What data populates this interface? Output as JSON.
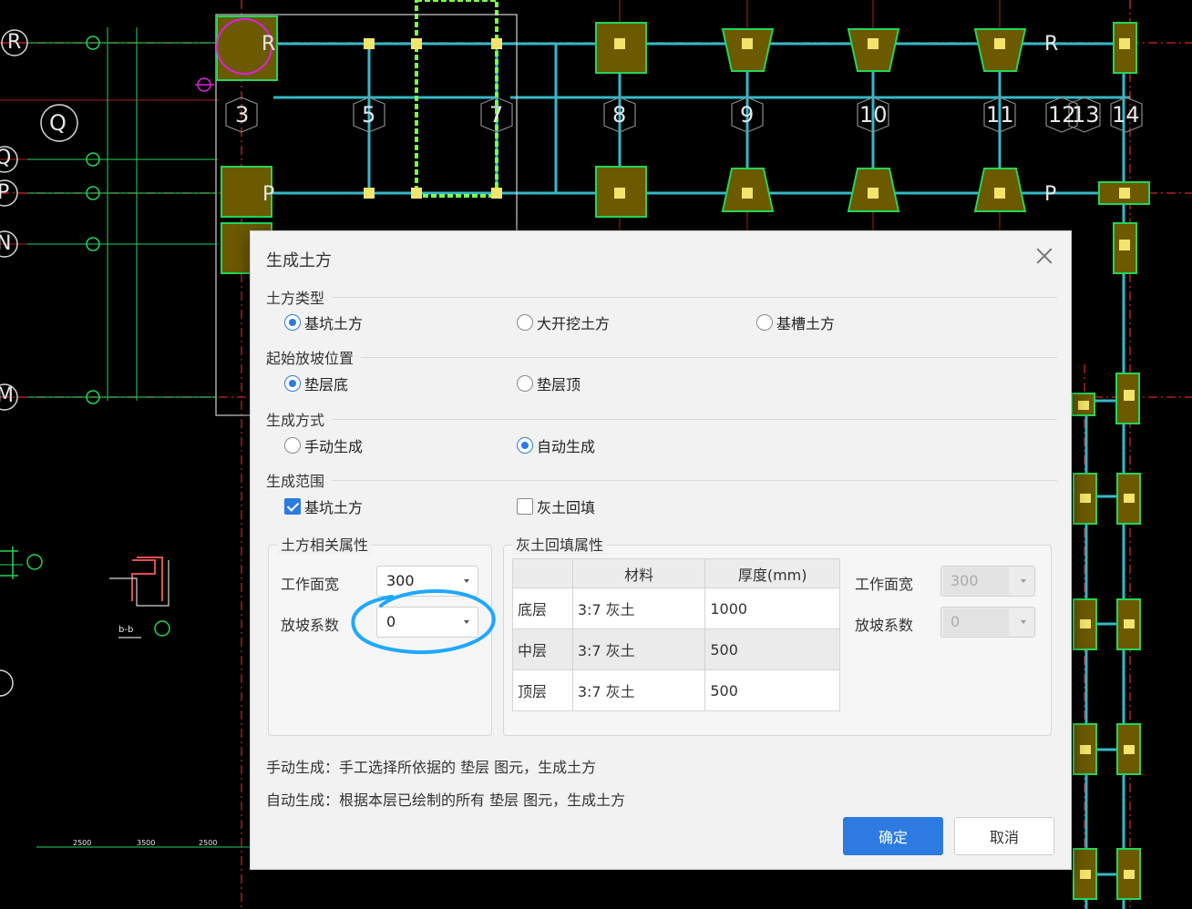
{
  "cad": {
    "axis_rows": [
      "R",
      "Q",
      "Q",
      "P",
      "N",
      "M"
    ],
    "axis_cols": [
      "3",
      "5",
      "7",
      "8",
      "9",
      "10",
      "11",
      "12",
      "13",
      "14"
    ],
    "row_tags": [
      "R",
      "P",
      "R",
      "P"
    ],
    "section_label": "b-b",
    "dims": [
      "2500",
      "3500",
      "2500"
    ]
  },
  "dialog": {
    "title": "生成土方",
    "sections": {
      "type": {
        "heading": "土方类型",
        "options": [
          "基坑土方",
          "大开挖土方",
          "基槽土方"
        ],
        "selected": "基坑土方"
      },
      "slope_start": {
        "heading": "起始放坡位置",
        "options": [
          "垫层底",
          "垫层顶"
        ],
        "selected": "垫层底"
      },
      "method": {
        "heading": "生成方式",
        "options": [
          "手动生成",
          "自动生成"
        ],
        "selected": "自动生成"
      },
      "range": {
        "heading": "生成范围",
        "options": [
          "基坑土方",
          "灰土回填"
        ],
        "checked": [
          "基坑土方"
        ]
      }
    },
    "earth_props": {
      "title": "土方相关属性",
      "work_width_label": "工作面宽",
      "work_width_value": "300",
      "slope_label": "放坡系数",
      "slope_value": "0"
    },
    "backfill_props": {
      "title": "灰土回填属性",
      "columns": [
        "",
        "材料",
        "厚度(mm)"
      ],
      "rows": [
        [
          "底层",
          "3:7 灰土",
          "1000"
        ],
        [
          "中层",
          "3:7 灰土",
          "500"
        ],
        [
          "顶层",
          "3:7 灰土",
          "500"
        ]
      ],
      "work_width_label": "工作面宽",
      "work_width_value": "300",
      "slope_label": "放坡系数",
      "slope_value": "0"
    },
    "notes": [
      "手动生成：手工选择所依据的 垫层 图元，生成土方",
      "自动生成：根据本层已绘制的所有 垫层 图元，生成土方"
    ],
    "ok_label": "确定",
    "cancel_label": "取消"
  },
  "colors": {
    "accent": "#2d7be0",
    "cad_footing": "#6b5a00",
    "cad_outline": "#22d65a",
    "cad_beam": "#35b8c8",
    "cad_axis_red": "#c62828",
    "annotation": "#1fa8ff"
  }
}
